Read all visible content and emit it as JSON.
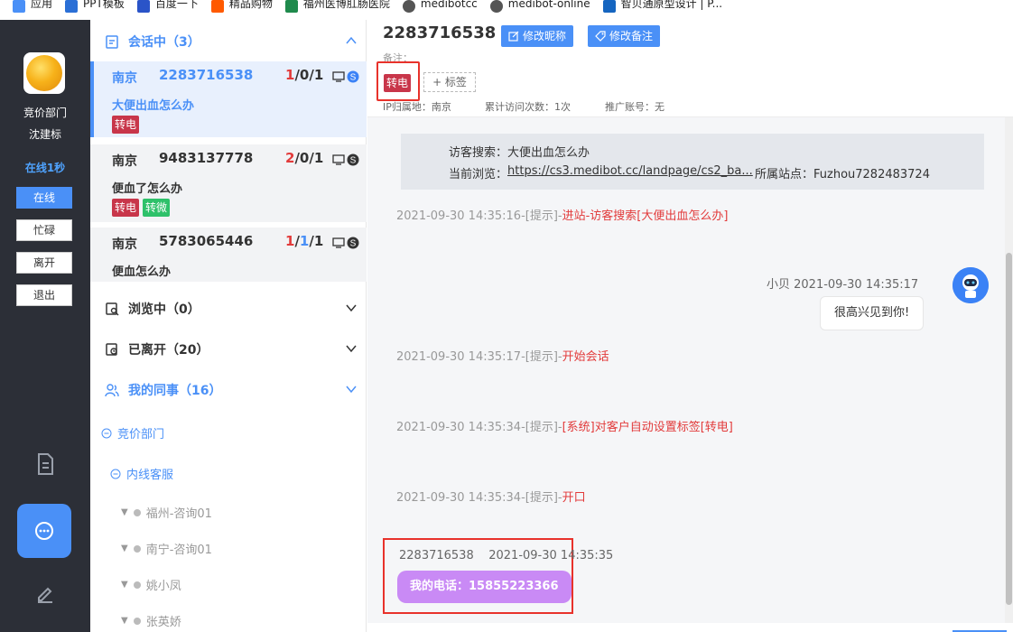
{
  "bookmarks": [
    {
      "label": "应用",
      "icon": "apps-icon",
      "color": "#4a90f7"
    },
    {
      "label": "PPT模板",
      "icon": "ppt-icon",
      "color": "#2a6fd6"
    },
    {
      "label": "百度一下",
      "icon": "paw-icon",
      "color": "#2a54c8"
    },
    {
      "label": "精品购物",
      "icon": "shop-icon",
      "color": "#ff5a00"
    },
    {
      "label": "福州医博肛肠医院",
      "icon": "hospital-icon",
      "color": "#1f8a4c"
    },
    {
      "label": "medibotcc",
      "icon": "globe-icon",
      "color": "#555555"
    },
    {
      "label": "medibot-online",
      "icon": "globe-icon",
      "color": "#555555"
    },
    {
      "label": "智贝通原型设计 | P...",
      "icon": "on-icon",
      "color": "#1565c0"
    }
  ],
  "sidebar": {
    "dept": "竞价部门",
    "user": "沈建标",
    "online_time": "在线1秒",
    "status_buttons": [
      "在线",
      "忙碌",
      "离开",
      "退出"
    ]
  },
  "groups": {
    "active": {
      "title": "会话中（3）"
    },
    "browsing": {
      "title": "浏览中（0）"
    },
    "left": {
      "title": "已离开（20）"
    },
    "colleagues": {
      "title": "我的同事（16）"
    }
  },
  "sessions": [
    {
      "city": "南京",
      "id": "2283716538",
      "c1": "1",
      "c2": "0",
      "c3": "1",
      "query": "大便出血怎么办",
      "tags": [
        "转电"
      ]
    },
    {
      "city": "南京",
      "id": "9483137778",
      "c1": "2",
      "c2": "0",
      "c3": "1",
      "query": "便血了怎么办",
      "tags": [
        "转电",
        "转微"
      ]
    },
    {
      "city": "南京",
      "id": "5783065446",
      "c1": "1",
      "c2": "1",
      "c3": "1",
      "query": "便血怎么办",
      "tags": []
    }
  ],
  "tree": {
    "dept": "竞价部门",
    "sub": "内线客服",
    "members": [
      "福州-咨询01",
      "南宁-咨询01",
      "姚小凤",
      "张英娇"
    ]
  },
  "header": {
    "visitor_id": "2283716538",
    "edit_nick": "修改昵称",
    "edit_remark": "修改备注",
    "remark_label": "备注：",
    "tag": "转电",
    "add_tag": "+ 标签",
    "ip": "IP归属地：南京",
    "visits": "累计访问次数：1次",
    "promo": "推广账号：无"
  },
  "chat": {
    "info": {
      "search": "访客搜索：大便出血怎么办",
      "browse_label": "当前浏览：",
      "browse_url": "https://cs3.medibot.cc/landpage/cs2_ba...",
      "site": "所属站点：Fuzhou7282483724"
    },
    "sys1": {
      "prefix": "2021-09-30 14:35:16-[提示]-",
      "text": "进站-访客搜索[大便出血怎么办]"
    },
    "bot": {
      "meta": "小贝 2021-09-30 14:35:17",
      "message": "很高兴见到你!"
    },
    "sys2": {
      "prefix": "2021-09-30 14:35:17-[提示]-",
      "text": "开始会话"
    },
    "sys3": {
      "prefix": "2021-09-30 14:35:34-[提示]-",
      "text": "[系统]对客户自动设置标签[转电]"
    },
    "sys4": {
      "prefix": "2021-09-30 14:35:34-[提示]-",
      "text": "开口"
    },
    "visitor": {
      "meta": "2283716538    2021-09-30 14:35:35",
      "message": "我的电话：15855223366"
    }
  },
  "colors": {
    "accent": "#4a90f7",
    "highlight_box": "#e8322b",
    "tag_red": "#c8364a",
    "tag_green": "#2ec16a",
    "visitor_bubble": "#c98af5"
  }
}
